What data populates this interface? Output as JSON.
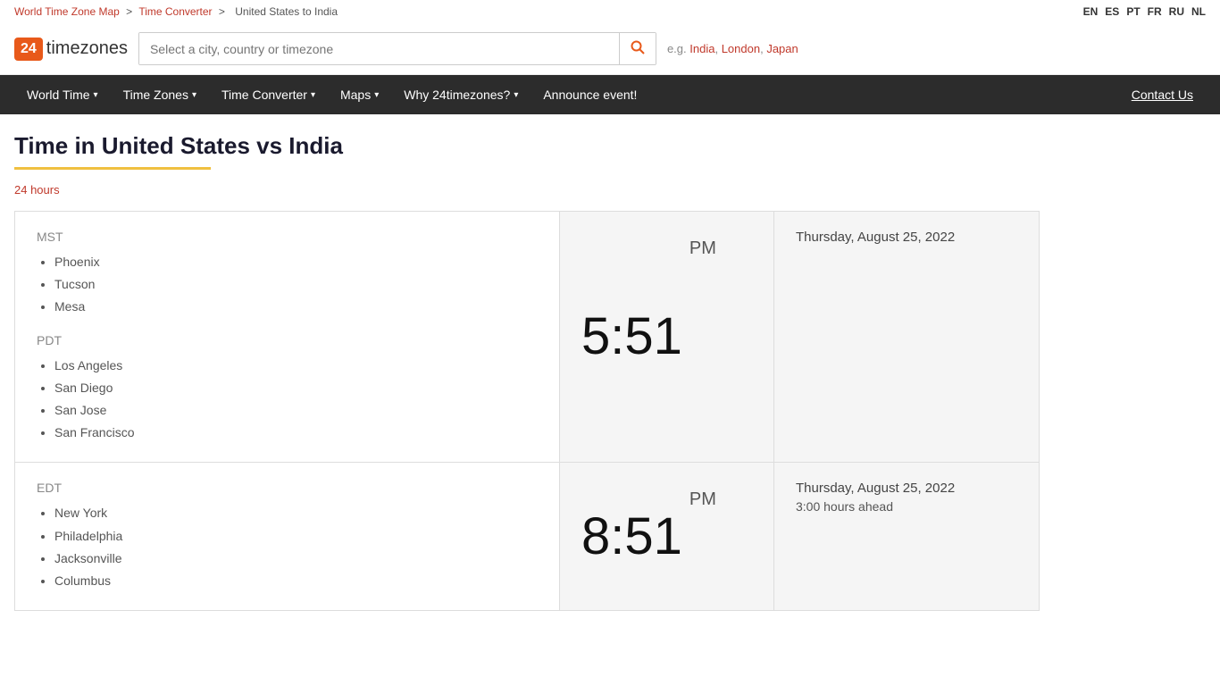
{
  "topbar": {
    "breadcrumb": [
      {
        "label": "World Time Zone Map",
        "href": "#"
      },
      {
        "label": "Time Converter",
        "href": "#"
      },
      {
        "label": "United States to India"
      }
    ],
    "languages": [
      "EN",
      "ES",
      "PT",
      "FR",
      "RU",
      "NL"
    ]
  },
  "header": {
    "logo_number": "24",
    "logo_text": "timezones",
    "search_placeholder": "Select a city, country or timezone",
    "examples_label": "e.g.",
    "examples": [
      {
        "label": "India",
        "href": "#"
      },
      {
        "label": "London",
        "href": "#"
      },
      {
        "label": "Japan",
        "href": "#"
      }
    ]
  },
  "nav": {
    "items": [
      {
        "label": "World Time",
        "has_dropdown": true
      },
      {
        "label": "Time Zones",
        "has_dropdown": true
      },
      {
        "label": "Time Converter",
        "has_dropdown": true
      },
      {
        "label": "Maps",
        "has_dropdown": true
      },
      {
        "label": "Why 24timezones?",
        "has_dropdown": true
      },
      {
        "label": "Announce event!"
      }
    ],
    "contact": "Contact Us"
  },
  "page": {
    "title": "Time in United States vs India",
    "hours_link": "24 hours"
  },
  "time_rows": [
    {
      "timezone_groups": [
        {
          "label": "MST",
          "cities": [
            "Phoenix",
            "Tucson",
            "Mesa"
          ]
        },
        {
          "label": "PDT",
          "cities": [
            "Los Angeles",
            "San Diego",
            "San Jose",
            "San Francisco"
          ]
        }
      ],
      "time": "5:51",
      "ampm": "PM",
      "date": "Thursday, August 25, 2022",
      "ahead": ""
    },
    {
      "timezone_groups": [
        {
          "label": "EDT",
          "cities": [
            "New York",
            "Philadelphia",
            "Jacksonville",
            "Columbus"
          ]
        }
      ],
      "time": "8:51",
      "ampm": "PM",
      "date": "Thursday, August 25, 2022",
      "ahead": "3:00 hours ahead"
    }
  ]
}
